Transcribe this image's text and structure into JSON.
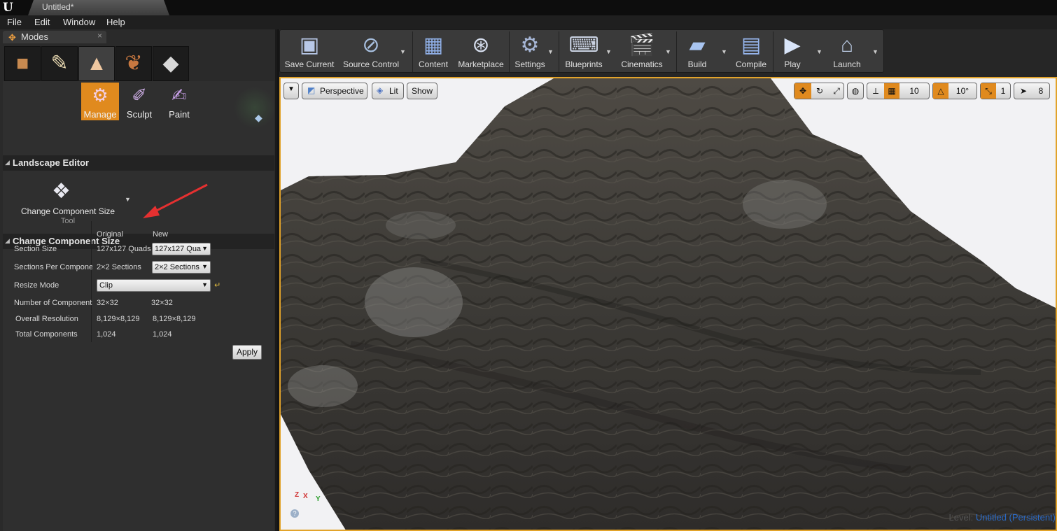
{
  "window": {
    "logo": "U",
    "doc_tab": "Untitled*"
  },
  "menu": [
    "File",
    "Edit",
    "Window",
    "Help"
  ],
  "modes_panel": {
    "tab_label": "Modes",
    "mode_icons": [
      "place-mode-icon",
      "paint-mode-icon",
      "landscape-mode-icon",
      "foliage-mode-icon",
      "geometry-mode-icon"
    ],
    "landscape_tools": [
      {
        "label": "Manage",
        "active": true
      },
      {
        "label": "Sculpt",
        "active": false
      },
      {
        "label": "Paint",
        "active": false
      }
    ],
    "landscape_editor_header": "Landscape Editor",
    "current_tool": {
      "name": "Change Component Size",
      "sub": "Tool"
    },
    "ccs_header": "Change Component Size",
    "columns": {
      "original": "Original",
      "new": "New"
    },
    "rows": {
      "section_size": {
        "label": "Section Size",
        "original": "127x127 Quads",
        "new": "127x127 Qua"
      },
      "sections_per_component": {
        "label": "Sections Per Component",
        "original": "2×2 Sections",
        "new": "2×2 Sections"
      },
      "resize_mode": {
        "label": "Resize Mode",
        "value": "Clip"
      },
      "number_of_components": {
        "label": "Number of Components",
        "original": "32×32",
        "new": "32×32"
      },
      "overall_resolution": {
        "label": "Overall Resolution",
        "original": "8,129×8,129",
        "new": "8,129×8,129"
      },
      "total_components": {
        "label": "Total Components",
        "original": "1,024",
        "new": "1,024"
      }
    },
    "apply_label": "Apply"
  },
  "toolbar": [
    {
      "label": "Save Current",
      "icon": "save-icon",
      "dropdown": false
    },
    {
      "label": "Source Control",
      "icon": "source-control-icon",
      "dropdown": true
    },
    {
      "label": "Content",
      "icon": "content-icon",
      "dropdown": false
    },
    {
      "label": "Marketplace",
      "icon": "marketplace-icon",
      "dropdown": false
    },
    {
      "label": "Settings",
      "icon": "settings-icon",
      "dropdown": true
    },
    {
      "label": "Blueprints",
      "icon": "blueprints-icon",
      "dropdown": true
    },
    {
      "label": "Cinematics",
      "icon": "cinematics-icon",
      "dropdown": true
    },
    {
      "label": "Build",
      "icon": "build-icon",
      "dropdown": true
    },
    {
      "label": "Compile",
      "icon": "compile-icon",
      "dropdown": false
    },
    {
      "label": "Play",
      "icon": "play-icon",
      "dropdown": true
    },
    {
      "label": "Launch",
      "icon": "launch-icon",
      "dropdown": true
    }
  ],
  "viewport": {
    "view_mode": "Perspective",
    "lighting": "Lit",
    "show": "Show",
    "grid_snap": "10",
    "rotation_snap": "10°",
    "scale_snap": "1",
    "camera_speed": "8",
    "level_label": "Level:",
    "level_name": "Untitled (Persistent)",
    "axis": {
      "x": "X",
      "y": "Y",
      "z": "Z"
    }
  },
  "colors": {
    "accent": "#e08a1e",
    "viewport_border": "#e2a32a",
    "level_link": "#2a6ac8",
    "arrow": "#e53030"
  }
}
